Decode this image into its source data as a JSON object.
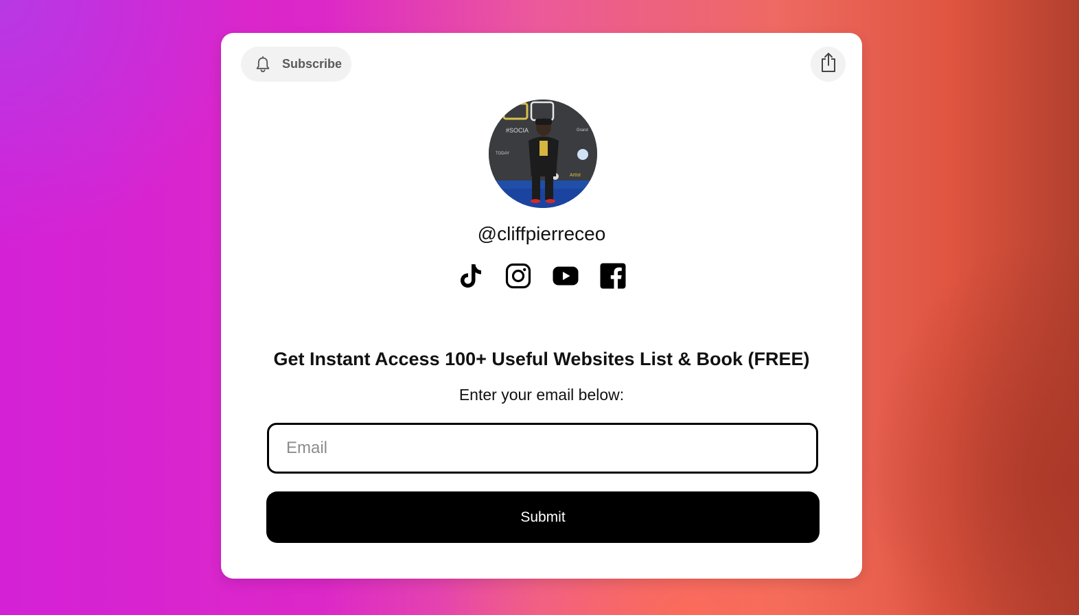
{
  "header": {
    "subscribe_label": "Subscribe",
    "subscribe_icon": "bell-icon",
    "share_icon": "share-icon"
  },
  "profile": {
    "handle": "@cliffpierreceo",
    "avatar": "profile-photo"
  },
  "socials": [
    {
      "name": "tiktok",
      "icon": "tiktok-icon"
    },
    {
      "name": "instagram",
      "icon": "instagram-icon"
    },
    {
      "name": "youtube",
      "icon": "youtube-icon"
    },
    {
      "name": "facebook",
      "icon": "facebook-icon"
    }
  ],
  "form": {
    "headline": "Get Instant Access 100+ Useful Websites List & Book (FREE)",
    "instruction": "Enter your email below:",
    "email_placeholder": "Email",
    "email_value": "",
    "submit_label": "Submit"
  },
  "colors": {
    "card_background": "#ffffff",
    "button_background": "#000000",
    "button_text": "#ffffff",
    "pill_background": "#f2f2f2"
  }
}
